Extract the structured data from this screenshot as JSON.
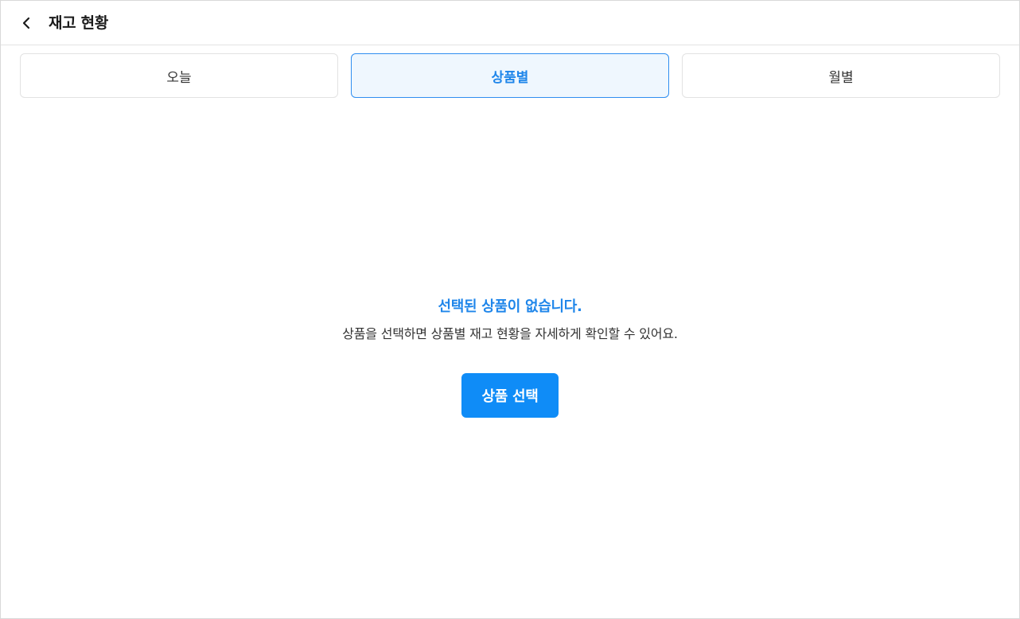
{
  "header": {
    "title": "재고 현황",
    "back_icon": "chevron-left-icon"
  },
  "tabs": [
    {
      "label": "오늘",
      "active": false
    },
    {
      "label": "상품별",
      "active": true
    },
    {
      "label": "월별",
      "active": false
    }
  ],
  "empty_state": {
    "title": "선택된 상품이 없습니다.",
    "description": "상품을 선택하면 상품별 재고 현황을 자세하게 확인할 수 있어요.",
    "button_label": "상품 선택"
  },
  "colors": {
    "accent": "#1f86ea",
    "button": "#0f8cf7",
    "active_tab_bg": "#eff7fe"
  }
}
